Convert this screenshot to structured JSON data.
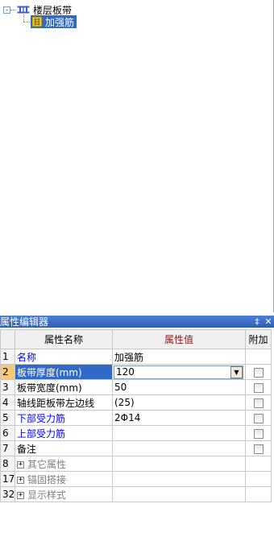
{
  "tree": {
    "root": {
      "label": "楼层板带",
      "toggle": "-"
    },
    "child": {
      "label": "加强筋"
    }
  },
  "property_editor": {
    "title": "属性编辑器",
    "pin_glyph": "‡",
    "close_glyph": "✕",
    "headers": {
      "name": "属性名称",
      "value": "属性值",
      "extra": "附加"
    },
    "rows": [
      {
        "num": "1",
        "name": "名称",
        "value": "加强筋"
      },
      {
        "num": "2",
        "name": "板带厚度(mm)",
        "value": "120"
      },
      {
        "num": "3",
        "name": "板带宽度(mm)",
        "value": "50"
      },
      {
        "num": "4",
        "name": "轴线距板带左边线",
        "value": "(25)"
      },
      {
        "num": "5",
        "name": "下部受力筋",
        "value": "2Φ14"
      },
      {
        "num": "6",
        "name": "上部受力筋",
        "value": ""
      },
      {
        "num": "7",
        "name": "备注",
        "value": ""
      },
      {
        "num": "8",
        "name": "其它属性",
        "value": "",
        "expander": "+"
      },
      {
        "num": "17",
        "name": "锚固搭接",
        "value": "",
        "expander": "+"
      },
      {
        "num": "32",
        "name": "显示样式",
        "value": "",
        "expander": "+"
      }
    ],
    "dropdown_glyph": "▼"
  }
}
